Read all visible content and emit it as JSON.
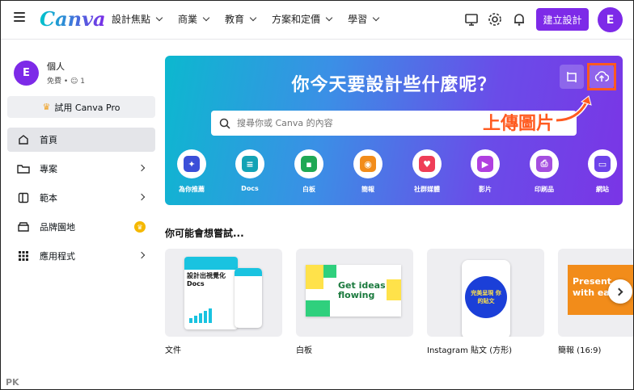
{
  "header": {
    "logo": "Canva",
    "nav": [
      "設計焦點",
      "商業",
      "教育",
      "方案和定價",
      "學習"
    ],
    "create_button": "建立設計",
    "avatar_initial": "E"
  },
  "sidebar": {
    "account_name": "個人",
    "account_sub": "免費 • ",
    "member_count": "1",
    "avatar_initial": "E",
    "try_pro": "試用 Canva Pro",
    "items": [
      {
        "label": "首頁",
        "icon": "home-icon"
      },
      {
        "label": "專案",
        "icon": "folder-icon"
      },
      {
        "label": "範本",
        "icon": "template-icon"
      },
      {
        "label": "品牌園地",
        "icon": "brand-icon"
      },
      {
        "label": "應用程式",
        "icon": "apps-icon"
      }
    ]
  },
  "hero": {
    "title": "你今天要設計些什麼呢？",
    "search_placeholder": "搜尋你或 Canva 的內容",
    "annotation": "上傳圖片",
    "categories": [
      {
        "label": "為你推薦",
        "color": "#3b4fd8"
      },
      {
        "label": "Docs",
        "color": "#13a3b5"
      },
      {
        "label": "白板",
        "color": "#1fa855"
      },
      {
        "label": "簡報",
        "color": "#f28c1a"
      },
      {
        "label": "社群媒體",
        "color": "#ef3d57"
      },
      {
        "label": "影片",
        "color": "#b03fe0"
      },
      {
        "label": "印刷品",
        "color": "#a44ee0"
      },
      {
        "label": "網站",
        "color": "#6d43ea"
      }
    ]
  },
  "suggestions": {
    "title": "你可能會想嘗試...",
    "cards": [
      {
        "label": "文件",
        "thumb_text": "設計出視覺化Docs"
      },
      {
        "label": "白板",
        "thumb_text": "Get ideas flowing"
      },
      {
        "label": "Instagram 貼文 (方形)",
        "thumb_text": "完美呈現 你的貼文"
      },
      {
        "label": "簡報 (16:9)",
        "thumb_text": "Present with ea"
      }
    ]
  },
  "watermark": "PK"
}
